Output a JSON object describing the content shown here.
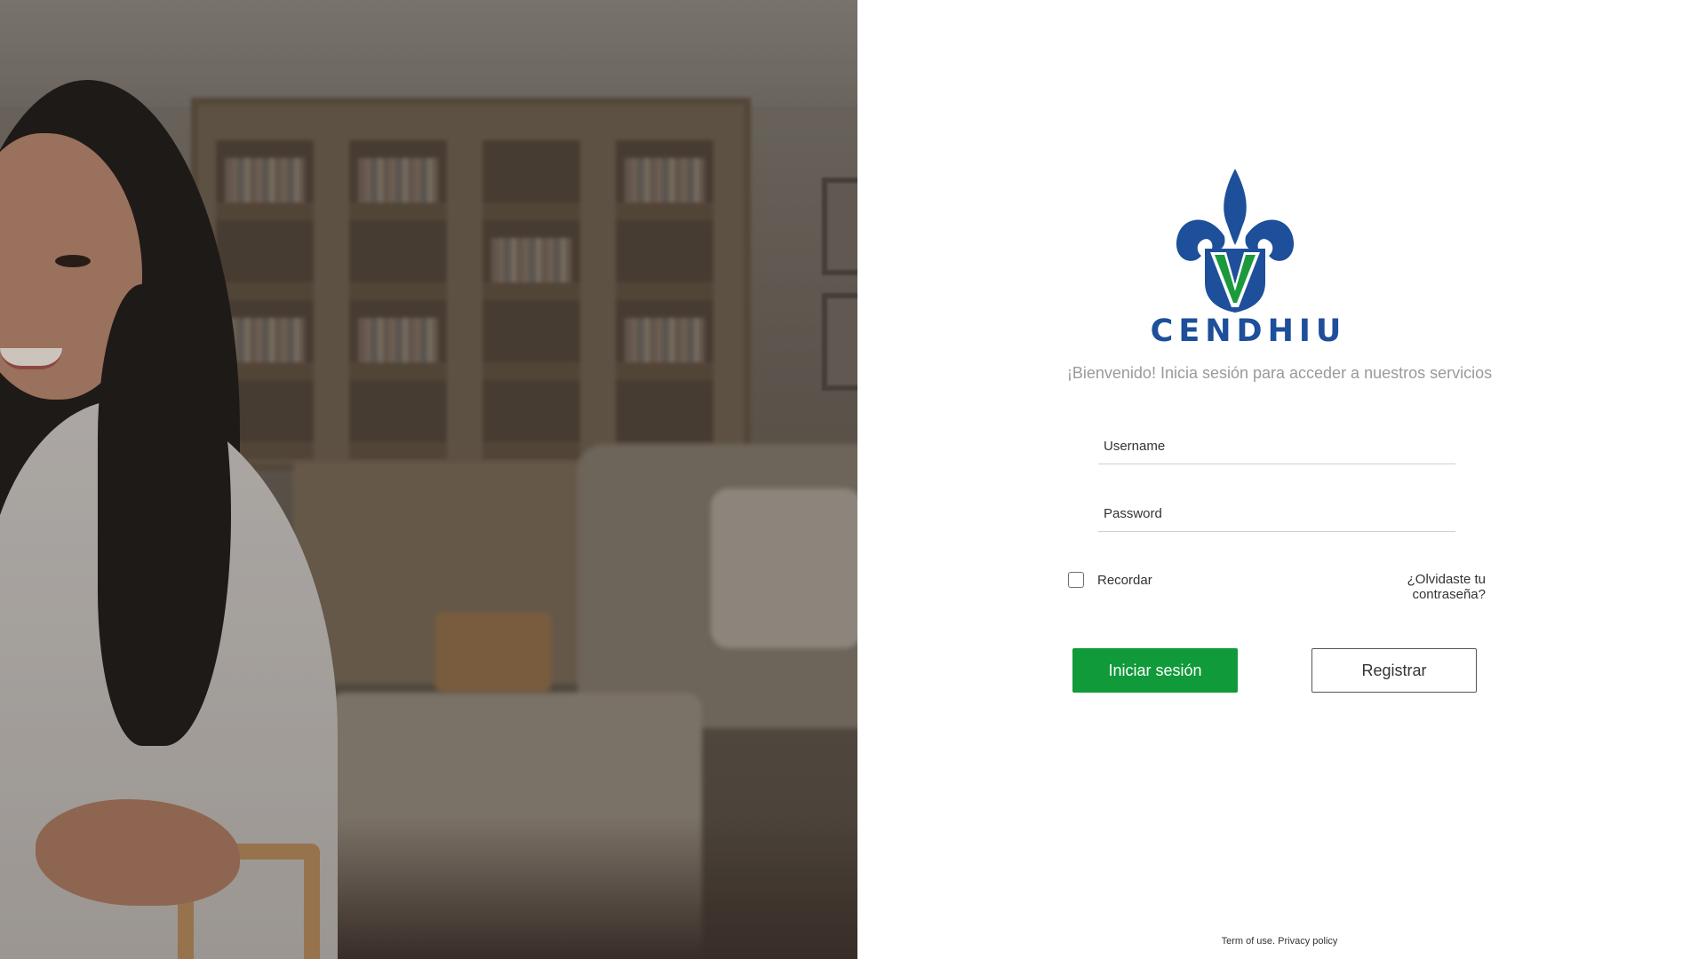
{
  "brand": {
    "name": "CENDHIU",
    "logo_icon": "fleur-de-lis-v-logo",
    "colors": {
      "blue": "#1d4f9a",
      "green": "#109a3a"
    }
  },
  "welcome_text": "¡Bienvenido! Inicia sesión para acceder a nuestros servicios",
  "form": {
    "username": {
      "placeholder": "Username",
      "value": ""
    },
    "password": {
      "placeholder": "Password",
      "value": ""
    },
    "remember_label": "Recordar",
    "remember_checked": false,
    "forgot_label": "¿Olvidaste tu contraseña?"
  },
  "buttons": {
    "login_label": "Iniciar sesión",
    "register_label": "Registrar"
  },
  "footer": {
    "terms_label": "Term of use.",
    "privacy_label": "Privacy policy"
  }
}
